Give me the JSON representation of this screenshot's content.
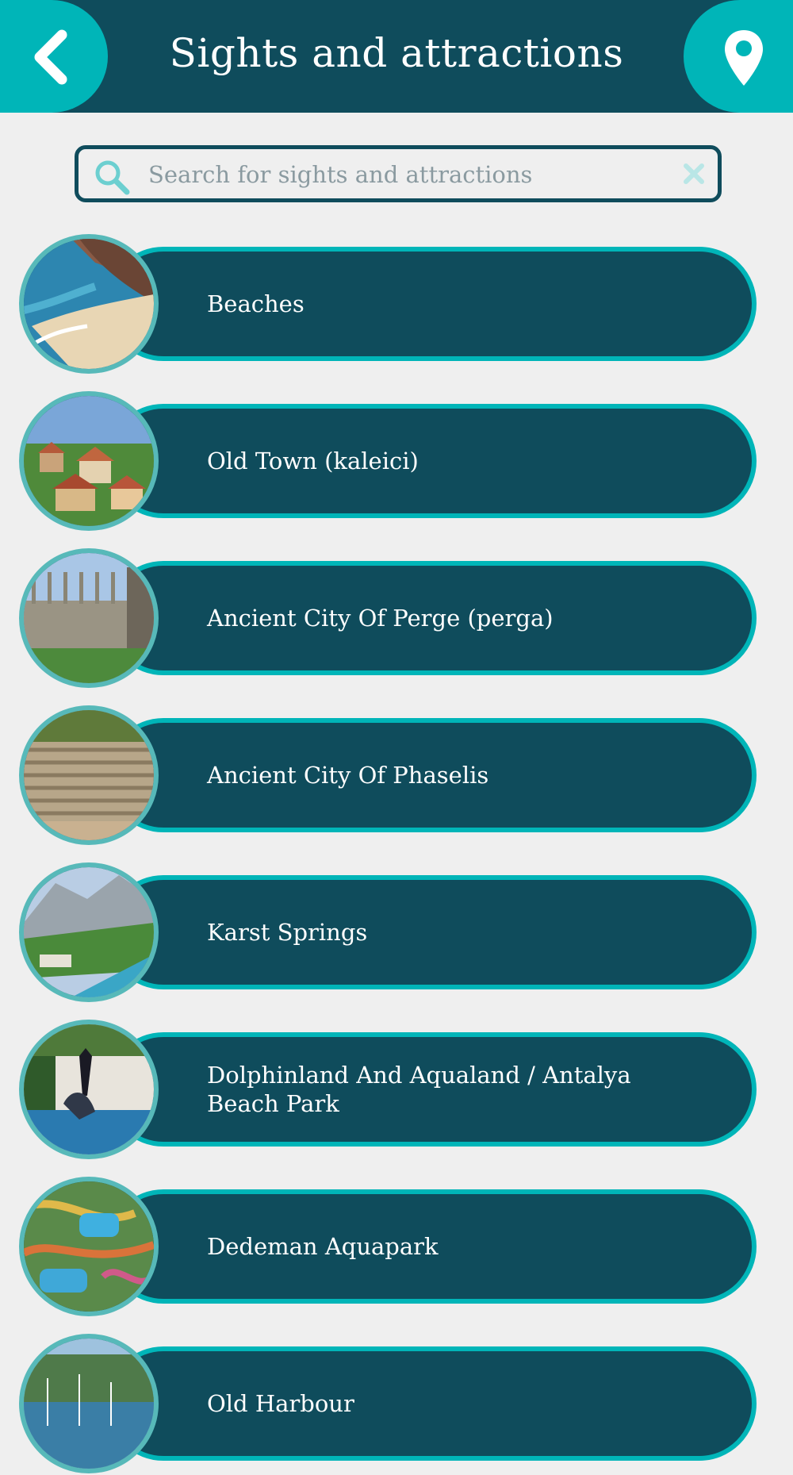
{
  "header": {
    "title": "Sights and attractions",
    "back_icon": "chevron-left-icon",
    "map_icon": "map-pin-icon"
  },
  "search": {
    "placeholder": "Search for sights and attractions",
    "value": "",
    "search_icon": "search-icon",
    "clear_icon": "close-icon"
  },
  "colors": {
    "header_bg": "#0f4c5c",
    "accent": "#00b5b8",
    "page_bg": "#efefef",
    "pill_bg": "#0f4c5c"
  },
  "items": [
    {
      "label": "Beaches"
    },
    {
      "label": "Old Town (kaleici)"
    },
    {
      "label": "Ancient City Of Perge (perga)"
    },
    {
      "label": "Ancient City Of Phaselis"
    },
    {
      "label": "Karst Springs"
    },
    {
      "label": "Dolphinland And Aqualand / Antalya Beach Park"
    },
    {
      "label": "Dedeman Aquapark"
    },
    {
      "label": "Old Harbour"
    }
  ]
}
